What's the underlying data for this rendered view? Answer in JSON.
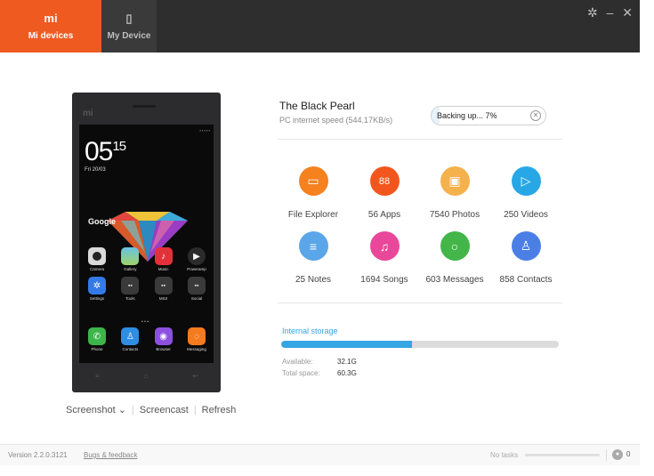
{
  "tabs": [
    {
      "label": "Mi devices",
      "icon": "mi-logo-icon",
      "icon_glyph": "mi"
    },
    {
      "label": "My Device",
      "icon": "phone-icon",
      "icon_glyph": "▯"
    }
  ],
  "window_controls": {
    "settings": "✲",
    "minimize": "–",
    "close": "✕"
  },
  "phone": {
    "logo": "mi",
    "clock_hour": "05",
    "clock_min": "15",
    "date": "Fri 20/03",
    "search_text": "Google",
    "apps": [
      [
        {
          "label": "Camera",
          "color": "#d9d9d9"
        },
        {
          "label": "Gallery",
          "color": "#69c3e5"
        },
        {
          "label": "Music",
          "color": "#e3313a"
        },
        {
          "label": "Poweramp",
          "color": "#2b2b2b"
        }
      ],
      [
        {
          "label": "Settings",
          "color": "#3479e8"
        },
        {
          "label": "Tools",
          "color": "#3a3a3a"
        },
        {
          "label": "MIUI",
          "color": "#3a3a3a"
        },
        {
          "label": "Social",
          "color": "#3a3a3a"
        }
      ]
    ],
    "dock": [
      {
        "label": "Phone",
        "color": "#3cb54a"
      },
      {
        "label": "Contacts",
        "color": "#2f8ee3"
      },
      {
        "label": "Browser",
        "color": "#8c4fe0"
      },
      {
        "label": "Messaging",
        "color": "#f47b1e"
      }
    ]
  },
  "phone_actions": {
    "screenshot": "Screenshot ⌄",
    "screencast": "Screencast",
    "refresh": "Refresh"
  },
  "device": {
    "name": "The Black Pearl",
    "speed": "PC internet speed (544.17KB/s)"
  },
  "backup": {
    "text": "Backing up... 7%",
    "progress": 7
  },
  "features": [
    {
      "label": "File Explorer",
      "color": "#f5811f",
      "glyph": "▭"
    },
    {
      "label": "56 Apps",
      "color": "#f2561d",
      "glyph": "88"
    },
    {
      "label": "7540 Photos",
      "color": "#f5b14c",
      "glyph": "▣"
    },
    {
      "label": "250 Videos",
      "color": "#27a7e6",
      "glyph": "▷"
    },
    {
      "label": "25 Notes",
      "color": "#5aa6e8",
      "glyph": "≡"
    },
    {
      "label": "1694 Songs",
      "color": "#e9479a",
      "glyph": "♫"
    },
    {
      "label": "603 Messages",
      "color": "#43b649",
      "glyph": "○"
    },
    {
      "label": "858 Contacts",
      "color": "#4b7fe6",
      "glyph": "♙"
    }
  ],
  "storage": {
    "label": "Internal storage",
    "used_percent": 47,
    "available_label": "Available:",
    "available_value": "32.1G",
    "total_label": "Total space:",
    "total_value": "60.3G"
  },
  "footer": {
    "version": "Version 2.2.0.3121",
    "feedback": "Bugs & feedback",
    "tasks": "No tasks",
    "task_count": "0"
  }
}
